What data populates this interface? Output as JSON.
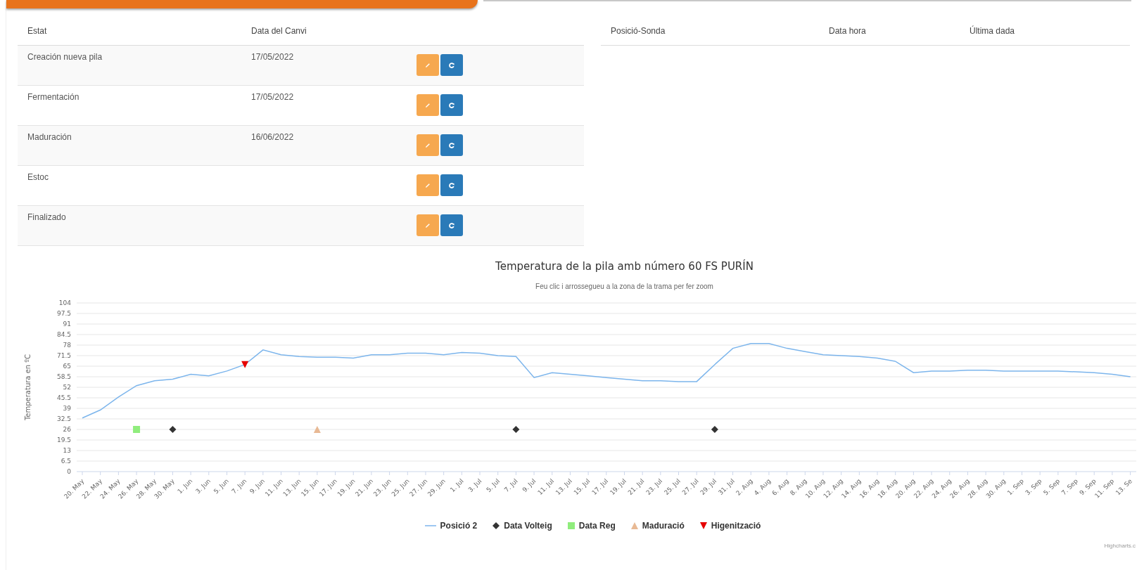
{
  "states_table": {
    "columns": [
      "Estat",
      "Data del Canvi"
    ],
    "rows": [
      {
        "state": "Creación nueva pila",
        "date": "17/05/2022"
      },
      {
        "state": "Fermentación",
        "date": "17/05/2022"
      },
      {
        "state": "Maduración",
        "date": "16/06/2022"
      },
      {
        "state": "Estoc"
      },
      {
        "state": "Finalizado"
      }
    ]
  },
  "probes_table": {
    "columns": [
      "Posició-Sonda",
      "Data hora",
      "Última dada"
    ]
  },
  "chart": {
    "subtitle": "Feu clic i arrossegueu a la zona de la trama per fer zoom",
    "credits": "Highcharts.c",
    "chart_data": {
      "type": "line",
      "title": "Temperatura de la pila amb número 60 FS PURÍN",
      "ylabel": "Temperatura en ºC",
      "categories": [
        "20. May",
        "22. May",
        "24. May",
        "26. May",
        "28. May",
        "30. May",
        "1. Jun",
        "3. Jun",
        "5. Jun",
        "7. Jun",
        "9. Jun",
        "11. Jun",
        "13. Jun",
        "15. Jun",
        "17. Jun",
        "19. Jun",
        "21. Jun",
        "23. Jun",
        "25. Jun",
        "27. Jun",
        "29. Jun",
        "1. Jul",
        "3. Jul",
        "5. Jul",
        "7. Jul",
        "9. Jul",
        "11. Jul",
        "13. Jul",
        "15. Jul",
        "17. Jul",
        "19. Jul",
        "21. Jul",
        "23. Jul",
        "25. Jul",
        "27. Jul",
        "29. Jul",
        "31. Jul",
        "2. Aug",
        "4. Aug",
        "6. Aug",
        "8. Aug",
        "10. Aug",
        "12. Aug",
        "14. Aug",
        "16. Aug",
        "18. Aug",
        "20. Aug",
        "22. Aug",
        "24. Aug",
        "26. Aug",
        "28. Aug",
        "30. Aug",
        "1. Sep",
        "3. Sep",
        "5. Sep",
        "7. Sep",
        "9. Sep",
        "11. Sep",
        "13. Se"
      ],
      "ylim": [
        0,
        104
      ],
      "grid": true,
      "legend": "bottom",
      "yticks": [
        0,
        6.5,
        13,
        19.5,
        26,
        32.5,
        39,
        45.5,
        52,
        58.5,
        65,
        71.5,
        78,
        84.5,
        91,
        97.5,
        104
      ],
      "series": [
        {
          "name": "Posició 2",
          "type": "line",
          "color": "#7cb5ec",
          "values": [
            33,
            38,
            46,
            53,
            56,
            57,
            60,
            59,
            62,
            66,
            75,
            72,
            71,
            70.5,
            70.5,
            70,
            72,
            72,
            73,
            73,
            72,
            73.5,
            73,
            71.5,
            71,
            58,
            61,
            60,
            59,
            58,
            57,
            56,
            56,
            55.5,
            55.5,
            66,
            76,
            79,
            79,
            76,
            74,
            72,
            71.5,
            71,
            70,
            68,
            61,
            62,
            62,
            62.5,
            62.5,
            62,
            62,
            62,
            62,
            61.5,
            61,
            60,
            58.5
          ]
        },
        {
          "name": "Data Volteig",
          "type": "scatter",
          "color": "#333333",
          "values": [
            null,
            null,
            null,
            null,
            null,
            26,
            null,
            null,
            null,
            null,
            null,
            null,
            null,
            null,
            null,
            null,
            null,
            null,
            null,
            null,
            null,
            null,
            null,
            null,
            26,
            null,
            null,
            null,
            null,
            null,
            null,
            null,
            null,
            null,
            null,
            26,
            null,
            null,
            null,
            null,
            null,
            null,
            null,
            null,
            null,
            null,
            null,
            null,
            null,
            null,
            null,
            null,
            null,
            null,
            null,
            null,
            null,
            null,
            null
          ]
        },
        {
          "name": "Data Reg",
          "type": "scatter",
          "color": "#90ed7d",
          "values": [
            null,
            null,
            null,
            26,
            null,
            null,
            null,
            null,
            null,
            null,
            null,
            null,
            null,
            null,
            null,
            null,
            null,
            null,
            null,
            null,
            null,
            null,
            null,
            null,
            null,
            null,
            null,
            null,
            null,
            null,
            null,
            null,
            null,
            null,
            null,
            null,
            null,
            null,
            null,
            null,
            null,
            null,
            null,
            null,
            null,
            null,
            null,
            null,
            null,
            null,
            null,
            null,
            null,
            null,
            null,
            null,
            null,
            null,
            null
          ]
        },
        {
          "name": "Maduració",
          "type": "scatter",
          "color": "#e8b994",
          "values": [
            null,
            null,
            null,
            null,
            null,
            null,
            null,
            null,
            null,
            null,
            null,
            null,
            null,
            26,
            null,
            null,
            null,
            null,
            null,
            null,
            null,
            null,
            null,
            null,
            null,
            null,
            null,
            null,
            null,
            null,
            null,
            null,
            null,
            null,
            null,
            null,
            null,
            null,
            null,
            null,
            null,
            null,
            null,
            null,
            null,
            null,
            null,
            null,
            null,
            null,
            null,
            null,
            null,
            null,
            null,
            null,
            null,
            null,
            null
          ]
        },
        {
          "name": "Higenització",
          "type": "scatter",
          "color": "#e60000",
          "values": [
            null,
            null,
            null,
            null,
            null,
            null,
            null,
            null,
            null,
            66,
            null,
            null,
            null,
            null,
            null,
            null,
            null,
            null,
            null,
            null,
            null,
            null,
            null,
            null,
            null,
            null,
            null,
            null,
            null,
            null,
            null,
            null,
            null,
            null,
            null,
            null,
            null,
            null,
            null,
            null,
            null,
            null,
            null,
            null,
            null,
            null,
            null,
            null,
            null,
            null,
            null,
            null,
            null,
            null,
            null,
            null,
            null,
            null,
            null
          ]
        }
      ]
    }
  }
}
